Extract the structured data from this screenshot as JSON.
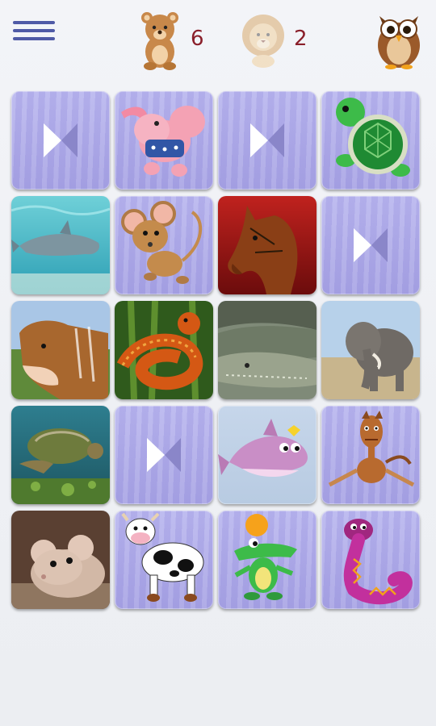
{
  "header": {
    "player1_score": "6",
    "player2_score": "2"
  },
  "board": {
    "rows": [
      [
        "back",
        "pink-elephant",
        "back",
        "green-turtle"
      ],
      [
        "dolphin-photo",
        "brown-mouse",
        "horse-photo",
        "back"
      ],
      [
        "cow-photo",
        "snake-photo",
        "crocodile-photo",
        "elephant-photo"
      ],
      [
        "sea-turtle-photo",
        "back",
        "pink-dolphin",
        "cartoon-horse"
      ],
      [
        "mouse-photo",
        "cartoon-cow",
        "green-crocodile",
        "purple-snake"
      ]
    ]
  },
  "colors": {
    "menu": "#4f5aa6",
    "score_text": "#8a1f2a",
    "card_back": "#aaa6e6"
  }
}
